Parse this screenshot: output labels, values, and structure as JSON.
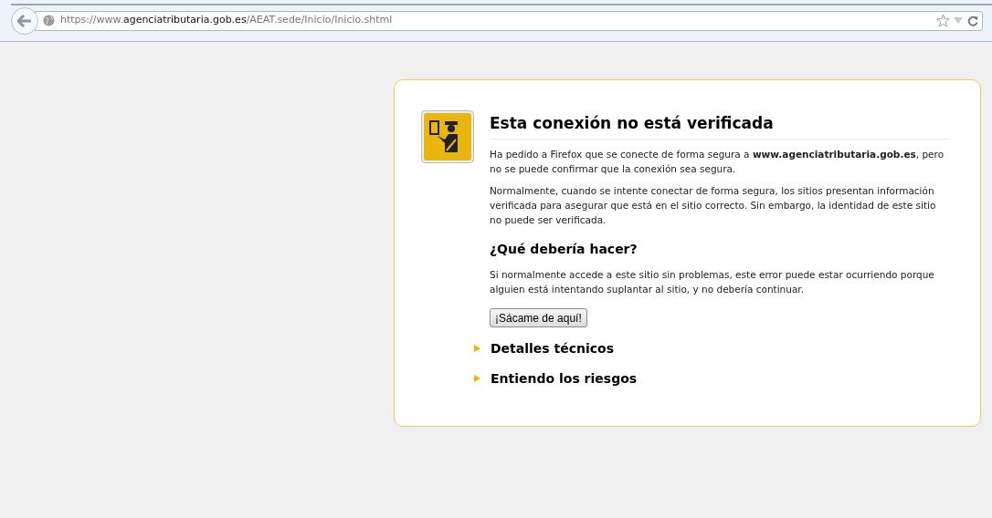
{
  "toolbar": {
    "url": {
      "prefix": "https://www.",
      "domain": "agenciatributaria.gob.es",
      "path": "/AEAT.sede/Inicio/Inicio.shtml"
    }
  },
  "error_page": {
    "title": "Esta conexión no está verificada",
    "paragraphs": [
      "Ha pedido a Firefox que se conecte de forma segura a **www.agenciatributaria.gob.es**, pero no se puede confirmar que la conexión sea segura.",
      "Normalmente, cuando se intente conectar de forma segura, los sitios presentan información verificada para asegurar que está en el sitio correcto. Sin embargo, la identidad de este sitio no puede ser verificada."
    ],
    "subtitle": "¿Qué debería hacer?",
    "advice": "Si normalmente accede a este sitio sin problemas, este error puede estar ocurriendo porque alguien está intentando suplantar al sitio, y no debería continuar.",
    "button": "¡Sácame de aquí!",
    "sections": [
      {
        "label": "Detalles técnicos",
        "expanded": false
      },
      {
        "label": "Entiendo los riesgos",
        "expanded": false
      }
    ]
  }
}
